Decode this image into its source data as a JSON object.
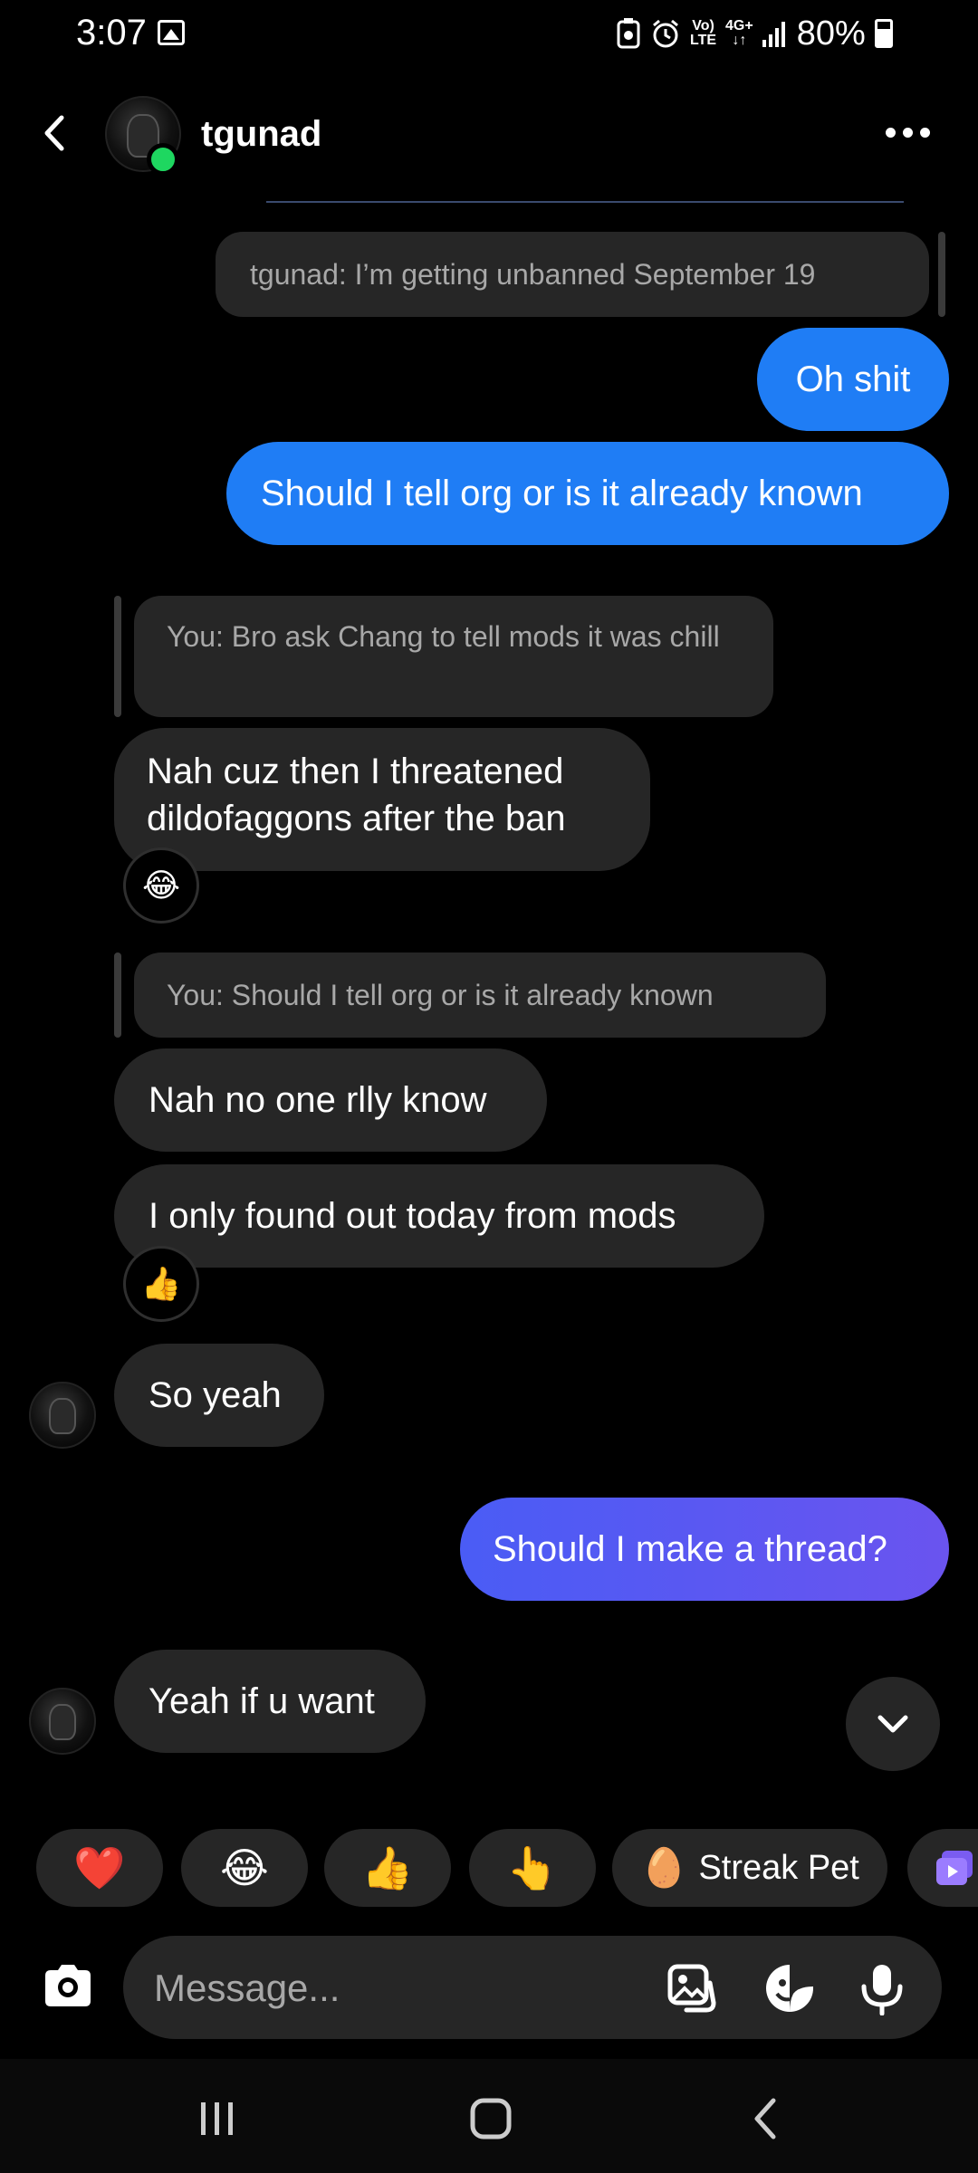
{
  "status_bar": {
    "time": "3:07",
    "network_top": "Vo)",
    "network_bottom": "LTE",
    "data_top": "4G+",
    "data_bottom": "↓↑",
    "battery": "80%"
  },
  "header": {
    "contact_name": "tgunad",
    "online": true
  },
  "conversation": {
    "pinned_text": "tgunad: I’m getting unbanned September 19",
    "messages": [
      {
        "id": "m1",
        "side": "sent",
        "text": "Oh shit"
      },
      {
        "id": "m2",
        "side": "sent",
        "text": "Should I tell org or is it already known"
      },
      {
        "id": "q1",
        "type": "reply_quote",
        "text": "You: Bro ask Chang to tell mods it was chill"
      },
      {
        "id": "m3",
        "side": "received",
        "text": "Nah cuz then I threatened dildofaggons after the ban",
        "reaction": "😂"
      },
      {
        "id": "q2",
        "type": "reply_quote",
        "text": "You: Should I tell org or is it already known"
      },
      {
        "id": "m4",
        "side": "received",
        "text": "Nah no one rlly know"
      },
      {
        "id": "m5",
        "side": "received",
        "text": "I only found out today from mods",
        "reaction": "👍"
      },
      {
        "id": "m6",
        "side": "received",
        "text": "So yeah"
      },
      {
        "id": "m7",
        "side": "sent",
        "text": "Should I make a thread?"
      },
      {
        "id": "m8",
        "side": "received",
        "text": "Yeah if u want"
      }
    ]
  },
  "quick_reactions": [
    {
      "emoji": "❤️"
    },
    {
      "emoji": "😂"
    },
    {
      "emoji": "👍"
    },
    {
      "emoji": "👆"
    },
    {
      "emoji": "🥚",
      "label": "Streak Pet"
    }
  ],
  "composer": {
    "placeholder": "Message..."
  },
  "colors": {
    "background": "#000000",
    "sent_blue": "#1f7df5",
    "sent_purple": "#5a5cf0",
    "received_bubble": "#262626",
    "online": "#1ed760"
  }
}
